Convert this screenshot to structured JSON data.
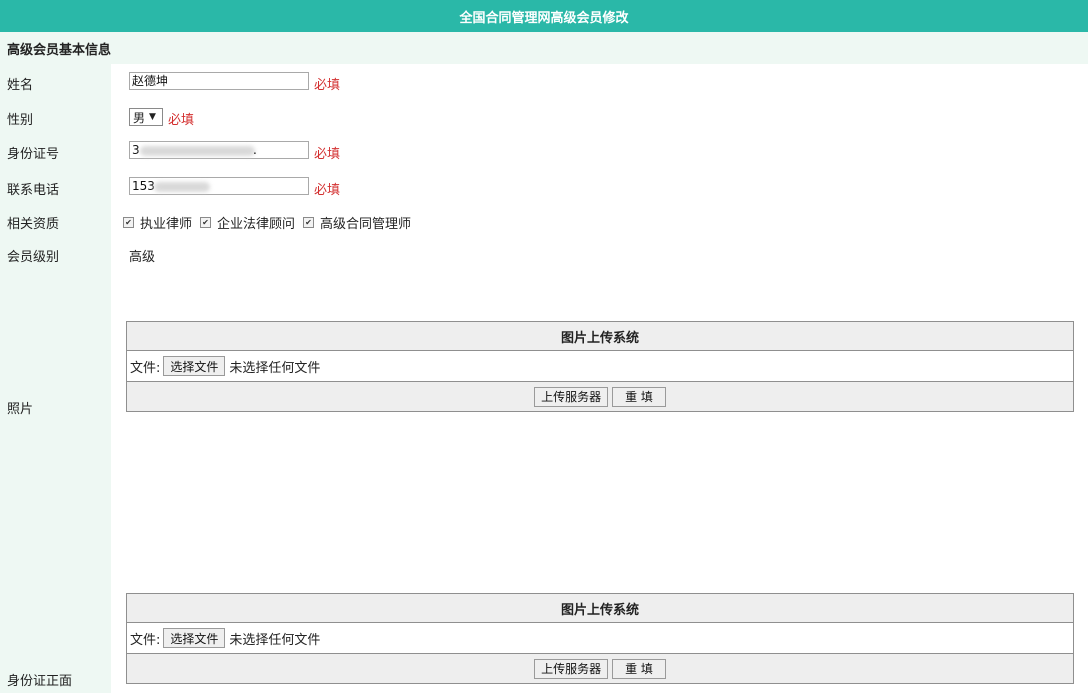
{
  "header": {
    "title": "全国合同管理网高级会员修改"
  },
  "section": {
    "title": "高级会员基本信息"
  },
  "form": {
    "name": {
      "label": "姓名",
      "value": "赵德坤",
      "required": "必填"
    },
    "gender": {
      "label": "性别",
      "value": "男",
      "required": "必填"
    },
    "id_number": {
      "label": "身份证号",
      "value_start": "3",
      "value_end": ".",
      "required": "必填"
    },
    "phone": {
      "label": "联系电话",
      "value": "153",
      "required": "必填"
    },
    "qualifications": {
      "label": "相关资质",
      "options": [
        {
          "label": "执业律师",
          "checked": true
        },
        {
          "label": "企业法律顾问",
          "checked": true
        },
        {
          "label": "高级合同管理师",
          "checked": true
        }
      ]
    },
    "level": {
      "label": "会员级别",
      "value": "高级"
    },
    "photo": {
      "label": "照片"
    },
    "id_front": {
      "label": "身份证正面"
    }
  },
  "uploader": {
    "title": "图片上传系统",
    "file_label": "文件:",
    "choose_button": "选择文件",
    "no_file": "未选择任何文件",
    "upload_button": "上传服务器",
    "reset_button": "重 填"
  },
  "colors": {
    "header_bg": "#2ab8a8",
    "label_bg": "#eef8f3",
    "required": "#d32f2f"
  }
}
